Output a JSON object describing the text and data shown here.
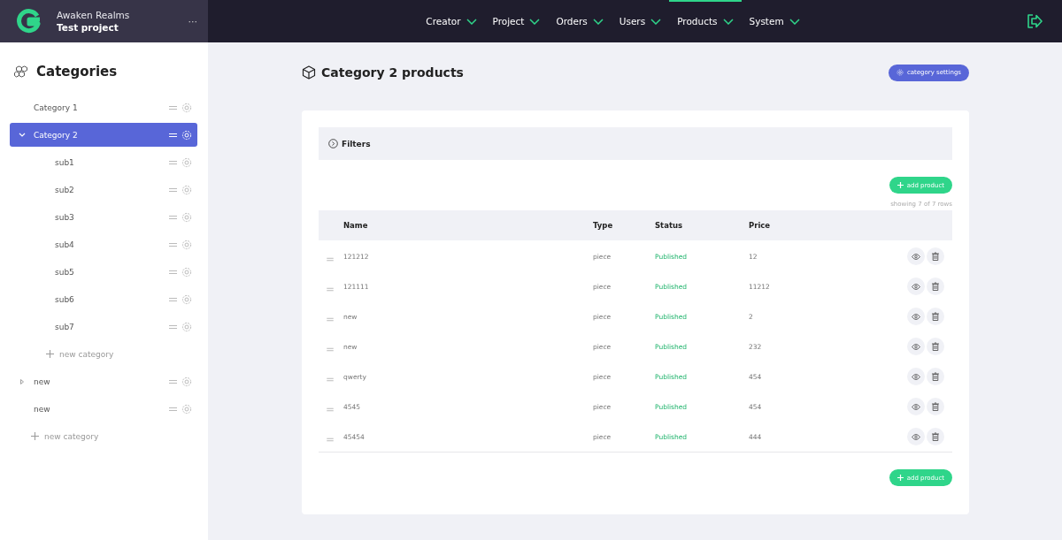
{
  "brand": {
    "company": "Awaken Realms",
    "project": "Test project",
    "more": "···"
  },
  "nav": [
    {
      "label": "Creator",
      "selected": false
    },
    {
      "label": "Project",
      "selected": false
    },
    {
      "label": "Orders",
      "selected": false
    },
    {
      "label": "Users",
      "selected": false
    },
    {
      "label": "Products",
      "selected": true
    },
    {
      "label": "System",
      "selected": false
    }
  ],
  "sidebar": {
    "title": "Categories",
    "add_label": "new category",
    "items": [
      {
        "label": "Category 1",
        "selected": false
      },
      {
        "label": "Category 2",
        "selected": true,
        "expanded": true,
        "add_label": "new category",
        "children": [
          {
            "label": "sub1",
            "selected": false
          },
          {
            "label": "sub2",
            "selected": false
          },
          {
            "label": "sub3",
            "selected": false
          },
          {
            "label": "sub4",
            "selected": false
          },
          {
            "label": "sub5",
            "selected": false
          },
          {
            "label": "sub6",
            "selected": false
          },
          {
            "label": "sub7",
            "selected": false
          }
        ]
      },
      {
        "label": "new",
        "selected": false,
        "expanded": false
      },
      {
        "label": "new",
        "selected": false
      }
    ]
  },
  "page": {
    "title": "Category 2 products",
    "settings_button": "category settings",
    "filters": "Filters",
    "add_button": "add product",
    "row_count": "showing 7 of 7 rows",
    "add_button_bottom": "add product"
  },
  "table": {
    "columns": [
      "Name",
      "Type",
      "Status",
      "Price"
    ],
    "rows": [
      {
        "name": "121212",
        "type": "piece",
        "status": "Published",
        "price": "12"
      },
      {
        "name": "121111",
        "type": "piece",
        "status": "Published",
        "price": "11212"
      },
      {
        "name": "new",
        "type": "piece",
        "status": "Published",
        "price": "2"
      },
      {
        "name": "new",
        "type": "piece",
        "status": "Published",
        "price": "232"
      },
      {
        "name": "qwerty",
        "type": "piece",
        "status": "Published",
        "price": "454"
      },
      {
        "name": "4545",
        "type": "piece",
        "status": "Published",
        "price": "454"
      },
      {
        "name": "45454",
        "type": "piece",
        "status": "Published",
        "price": "444"
      }
    ]
  }
}
